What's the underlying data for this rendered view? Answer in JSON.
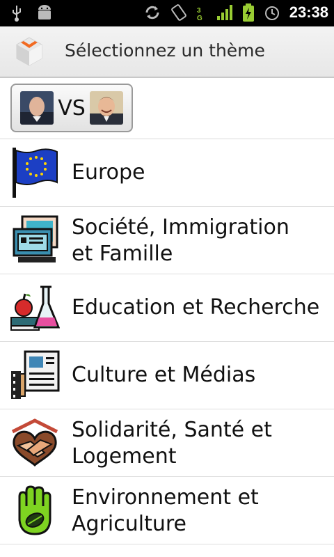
{
  "status_bar": {
    "time": "23:38",
    "icons": [
      "usb-icon",
      "android-debug-icon",
      "sync-icon",
      "rotation-icon",
      "network-3g-icon",
      "signal-icon",
      "battery-charging-icon",
      "alarm-icon"
    ]
  },
  "action_bar": {
    "title": "Sélectionnez un thème",
    "icon": "app-logo-icon"
  },
  "vs_button": {
    "label": "VS"
  },
  "themes": [
    {
      "label": "Europe",
      "icon": "eu-flag-icon"
    },
    {
      "label": "Société, Immigration et Famille",
      "line1": "Société, Immigration",
      "line2": "et Famille",
      "icon": "id-card-icon"
    },
    {
      "label": "Education et Recherche",
      "icon": "apple-flask-icon"
    },
    {
      "label": "Culture et Médias",
      "icon": "newspaper-film-icon"
    },
    {
      "label": "Solidarité, Santé et Logement",
      "line1": "Solidarité, Santé et",
      "line2": "Logement",
      "icon": "handshake-house-icon"
    },
    {
      "label": "Environnement et Agriculture",
      "line1": "Environnement et",
      "line2": "Agriculture",
      "icon": "green-hand-leaf-icon"
    }
  ]
}
